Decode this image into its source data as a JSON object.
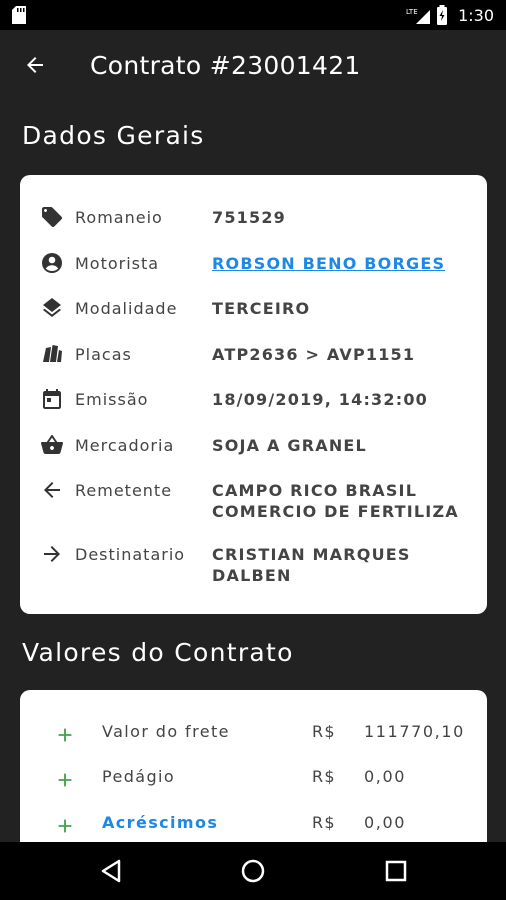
{
  "status_bar": {
    "time": "1:30",
    "network": "LTE"
  },
  "app_bar": {
    "title": "Contrato #23001421"
  },
  "sections": {
    "general_title": "Dados Gerais",
    "values_title": "Valores do Contrato"
  },
  "general": [
    {
      "icon": "tag-icon",
      "label": "Romaneio",
      "value": "751529"
    },
    {
      "icon": "account-circle-icon",
      "label": "Motorista",
      "value": "ROBSON BENO BORGES"
    },
    {
      "icon": "layers-icon",
      "label": "Modalidade",
      "value": "TERCEIRO"
    },
    {
      "icon": "plates-icon",
      "label": "Placas",
      "value": "ATP2636 > AVP1151"
    },
    {
      "icon": "calendar-icon",
      "label": "Emissão",
      "value": "18/09/2019, 14:32:00"
    },
    {
      "icon": "basket-icon",
      "label": "Mercadoria",
      "value": "SOJA A GRANEL"
    },
    {
      "icon": "arrow-left-icon",
      "label": "Remetente",
      "value": "CAMPO RICO BRASIL COMERCIO DE FERTILIZA"
    },
    {
      "icon": "arrow-right-icon",
      "label": "Destinatario",
      "value": "CRISTIAN MARQUES DALBEN"
    }
  ],
  "values": [
    {
      "label": "Valor do frete",
      "currency": "R$",
      "amount": "111770,10"
    },
    {
      "label": "Pedágio",
      "currency": "R$",
      "amount": "0,00"
    },
    {
      "label": "Acréscimos",
      "currency": "R$",
      "amount": "0,00"
    }
  ],
  "colors": {
    "background": "#222222",
    "card": "#ffffff",
    "accent_link": "#1e88e5",
    "plus_green": "#43a047"
  }
}
